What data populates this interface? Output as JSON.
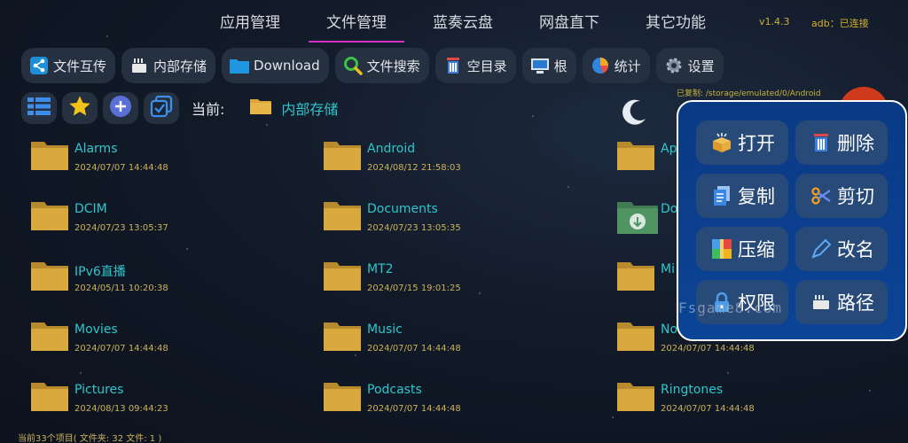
{
  "tabs": [
    {
      "label": "应用管理",
      "active": false
    },
    {
      "label": "文件管理",
      "active": true
    },
    {
      "label": "蓝奏云盘",
      "active": false
    },
    {
      "label": "网盘直下",
      "active": false
    },
    {
      "label": "其它功能",
      "active": false
    }
  ],
  "version": "v1.4.3",
  "adb_status": "adb：已连接",
  "toolbar": [
    {
      "label": "文件互传",
      "icon": "share-icon"
    },
    {
      "label": "内部存储",
      "icon": "sd-card-icon"
    },
    {
      "label": "Download",
      "icon": "folder-icon"
    },
    {
      "label": "文件搜索",
      "icon": "search-icon"
    },
    {
      "label": "空目录",
      "icon": "trash-icon"
    },
    {
      "label": "根",
      "icon": "monitor-icon"
    },
    {
      "label": "统计",
      "icon": "pie-chart-icon"
    },
    {
      "label": "设置",
      "icon": "gear-icon"
    }
  ],
  "current": {
    "label": "当前:",
    "path": "内部存储"
  },
  "copied_path": "已复制: /storage/emulated/0/Android",
  "files": [
    {
      "name": "Alarms",
      "date": "2024/07/07 14:44:48"
    },
    {
      "name": "Android",
      "date": "2024/08/12 21:58:03"
    },
    {
      "name": "Ap",
      "date": ""
    },
    {
      "name": "DCIM",
      "date": "2024/07/23 13:05:37"
    },
    {
      "name": "Documents",
      "date": "2024/07/23 13:05:35"
    },
    {
      "name": "Do",
      "date": ""
    },
    {
      "name": "IPv6直播",
      "date": "2024/05/11 10:20:38"
    },
    {
      "name": "MT2",
      "date": "2024/07/15 19:01:25"
    },
    {
      "name": "Mi",
      "date": ""
    },
    {
      "name": "Movies",
      "date": "2024/07/07 14:44:48"
    },
    {
      "name": "Music",
      "date": "2024/07/07 14:44:48"
    },
    {
      "name": "No",
      "date": "2024/07/07 14:44:48"
    },
    {
      "name": "Pictures",
      "date": "2024/08/13 09:44:23"
    },
    {
      "name": "Podcasts",
      "date": "2024/07/07 14:44:48"
    },
    {
      "name": "Ringtones",
      "date": "2024/07/07 14:44:48"
    }
  ],
  "status_text": "当前33个项目( 文件夹: 32  文件: 1 )",
  "popup": [
    {
      "label": "打开",
      "icon": "open-box-icon"
    },
    {
      "label": "删除",
      "icon": "delete-icon"
    },
    {
      "label": "复制",
      "icon": "copy-icon"
    },
    {
      "label": "剪切",
      "icon": "scissors-icon"
    },
    {
      "label": "压缩",
      "icon": "archive-icon"
    },
    {
      "label": "改名",
      "icon": "pen-icon"
    },
    {
      "label": "权限",
      "icon": "lock-icon"
    },
    {
      "label": "路径",
      "icon": "path-icon"
    }
  ],
  "watermark": "Fsgame8.com",
  "colors": {
    "accent": "#2fc6cc",
    "tab_underline": "#d22fc4",
    "date": "#cdb25a",
    "popup_bg": "#0b3f8f"
  }
}
